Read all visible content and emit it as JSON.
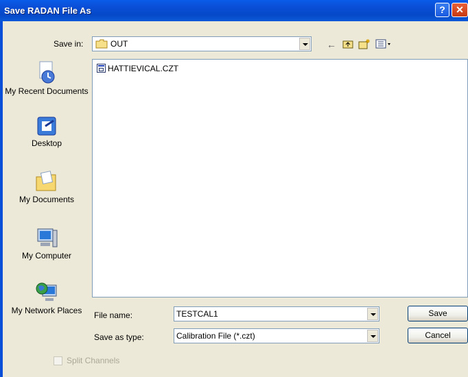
{
  "window": {
    "title": "Save RADAN File As",
    "help_glyph": "?",
    "close_glyph": "✕"
  },
  "save_in": {
    "label": "Save in:",
    "folder": "OUT"
  },
  "toolbar": {
    "back_icon": "back-arrow-icon",
    "up_icon": "up-folder-icon",
    "new_folder_icon": "new-folder-icon",
    "views_icon": "views-menu-icon"
  },
  "places": [
    {
      "label": "My Recent Documents",
      "icon": "recent-documents-icon"
    },
    {
      "label": "Desktop",
      "icon": "desktop-icon"
    },
    {
      "label": "My Documents",
      "icon": "my-documents-icon"
    },
    {
      "label": "My Computer",
      "icon": "my-computer-icon"
    },
    {
      "label": "My Network Places",
      "icon": "network-places-icon"
    }
  ],
  "files": [
    {
      "name": "HATTIEVICAL.CZT",
      "icon": "calibration-file-icon"
    }
  ],
  "file_name": {
    "label": "File name:",
    "value": "TESTCAL1"
  },
  "save_as_type": {
    "label": "Save as type:",
    "value": "Calibration File (*.czt)"
  },
  "buttons": {
    "save": "Save",
    "cancel": "Cancel"
  },
  "split_channels": {
    "label": "Split Channels",
    "checked": false,
    "enabled": false
  }
}
